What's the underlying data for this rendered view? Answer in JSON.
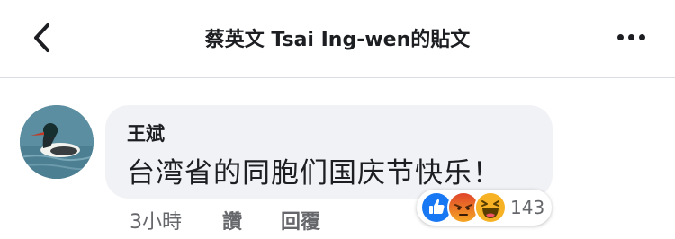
{
  "header": {
    "title": "蔡英文 Tsai Ing-wen的貼文",
    "back_icon": "chevron-left-icon",
    "more_icon": "more-dots-icon"
  },
  "comment": {
    "author": "王斌",
    "text": "台湾省的同胞们国庆节快乐！",
    "time": "3小時",
    "like_label": "讚",
    "reply_label": "回覆",
    "reactions": {
      "icons": [
        "like-reaction-icon",
        "angry-reaction-icon",
        "haha-reaction-icon"
      ],
      "count": "143"
    }
  },
  "colors": {
    "like_blue": "#1877f2",
    "angry_orange": "#e9710f",
    "haha_yellow": "#f7b125",
    "bubble_bg": "#f0f2f5",
    "secondary_text": "#65676b"
  }
}
